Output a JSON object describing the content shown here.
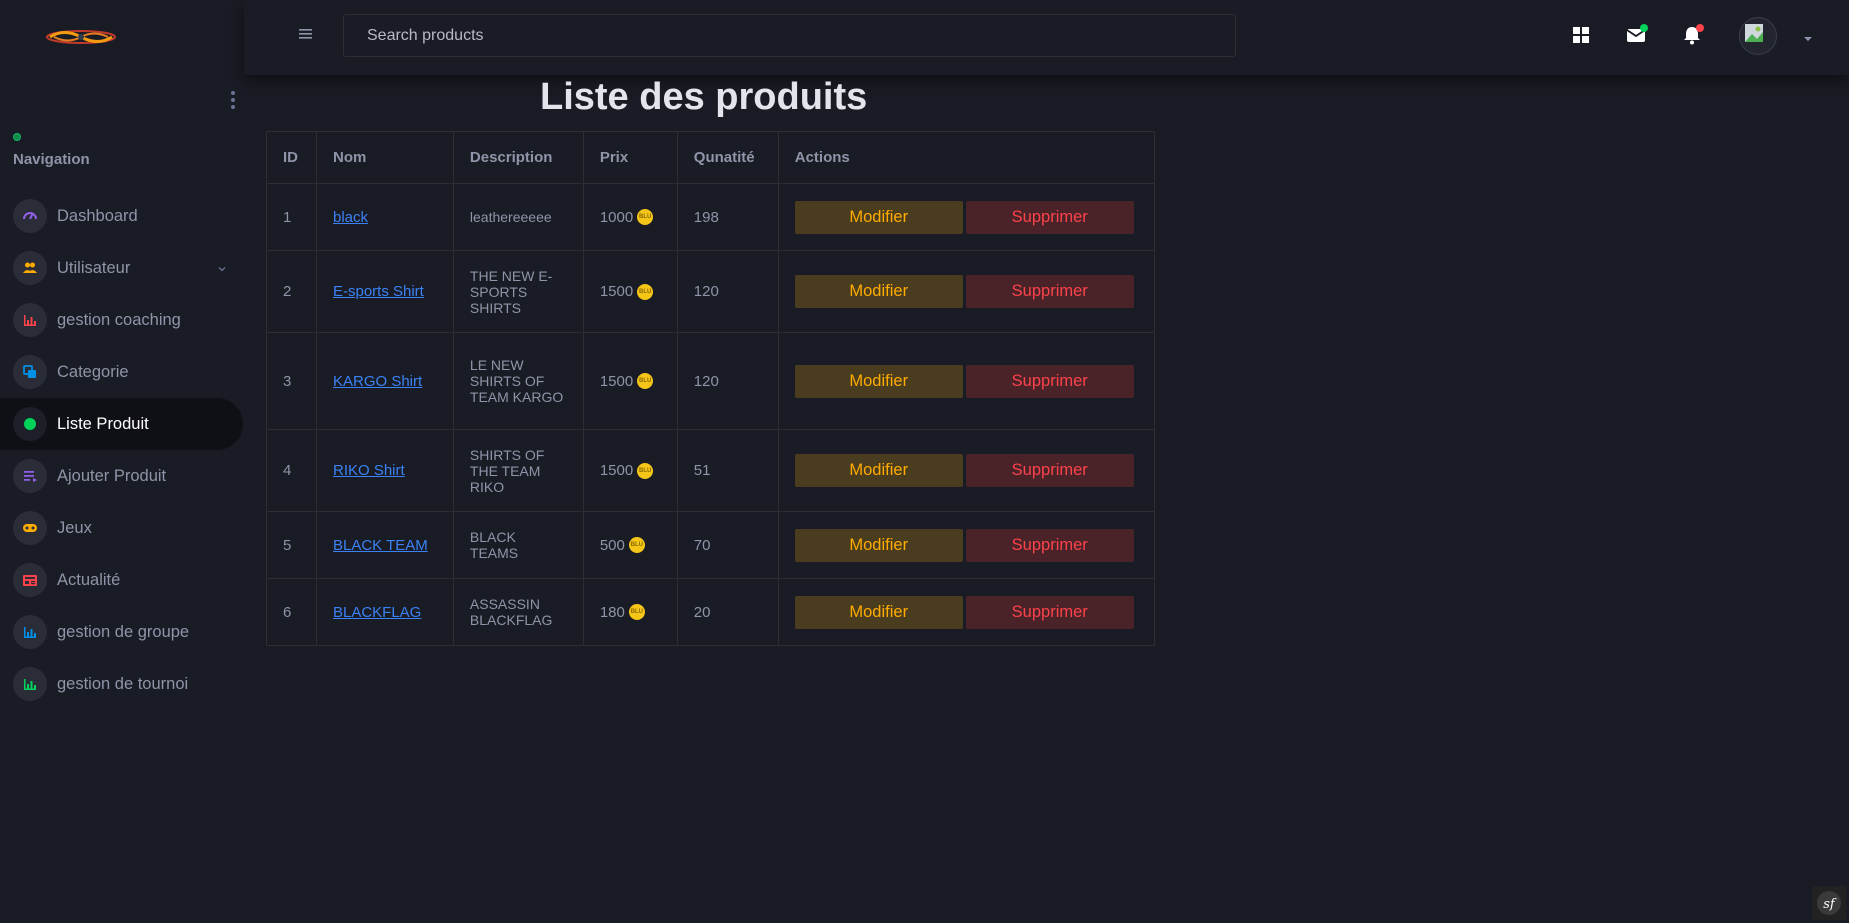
{
  "header": {
    "search_placeholder": "Search products"
  },
  "sidebar": {
    "nav_title": "Navigation",
    "items": [
      {
        "label": "Dashboard",
        "icon": "speedometer-icon",
        "color": "#8f5fe8"
      },
      {
        "label": "Utilisateur",
        "icon": "users-icon",
        "color": "#ffab00",
        "has_chevron": true
      },
      {
        "label": "gestion coaching",
        "icon": "bar-chart-icon",
        "color": "#fc424a"
      },
      {
        "label": "Categorie",
        "icon": "copy-icon",
        "color": "#0090e7"
      },
      {
        "label": "Liste Produit",
        "icon": "dot-icon",
        "color": "#00d25b",
        "active": true
      },
      {
        "label": "Ajouter Produit",
        "icon": "playlist-icon",
        "color": "#8f5fe8"
      },
      {
        "label": "Jeux",
        "icon": "gamepad-icon",
        "color": "#ffab00"
      },
      {
        "label": "Actualité",
        "icon": "news-icon",
        "color": "#fc424a"
      },
      {
        "label": "gestion de groupe",
        "icon": "bar-chart-icon",
        "color": "#0090e7"
      },
      {
        "label": "gestion de tournoi",
        "icon": "bar-chart-icon",
        "color": "#00d25b"
      }
    ]
  },
  "main": {
    "title": "Liste des produits",
    "columns": [
      "ID",
      "Nom",
      "Description",
      "Prix",
      "Qunatité",
      "Actions"
    ],
    "edit_label": "Modifier",
    "delete_label": "Supprimer",
    "rows": [
      {
        "id": "1",
        "name": "black",
        "description": "leatherеeeee",
        "price": "1000",
        "qty": "198"
      },
      {
        "id": "2",
        "name": "E-sports Shirt",
        "description": "THE NEW E-SPORTS SHIRTS",
        "price": "1500",
        "qty": "120"
      },
      {
        "id": "3",
        "name": "KARGO Shirt",
        "description": "LE NEW SHIRTS OF TEAM KARGO",
        "price": "1500",
        "qty": "120"
      },
      {
        "id": "4",
        "name": "RIKO Shirt",
        "description": "SHIRTS OF THE TEAM RIKO",
        "price": "1500",
        "qty": "51"
      },
      {
        "id": "5",
        "name": "BLACK TEAM",
        "description": "BLACK TEAMS",
        "price": "500",
        "qty": "70"
      },
      {
        "id": "6",
        "name": "BLACKFLAG",
        "description": "ASSASSIN BLACKFLAG",
        "price": "180",
        "qty": "20"
      }
    ]
  },
  "colors": {
    "background": "#191c24",
    "link": "#3b82f6",
    "edit_button_text": "#ffab00",
    "delete_button_text": "#fc424a",
    "coin": "#f5c518"
  }
}
